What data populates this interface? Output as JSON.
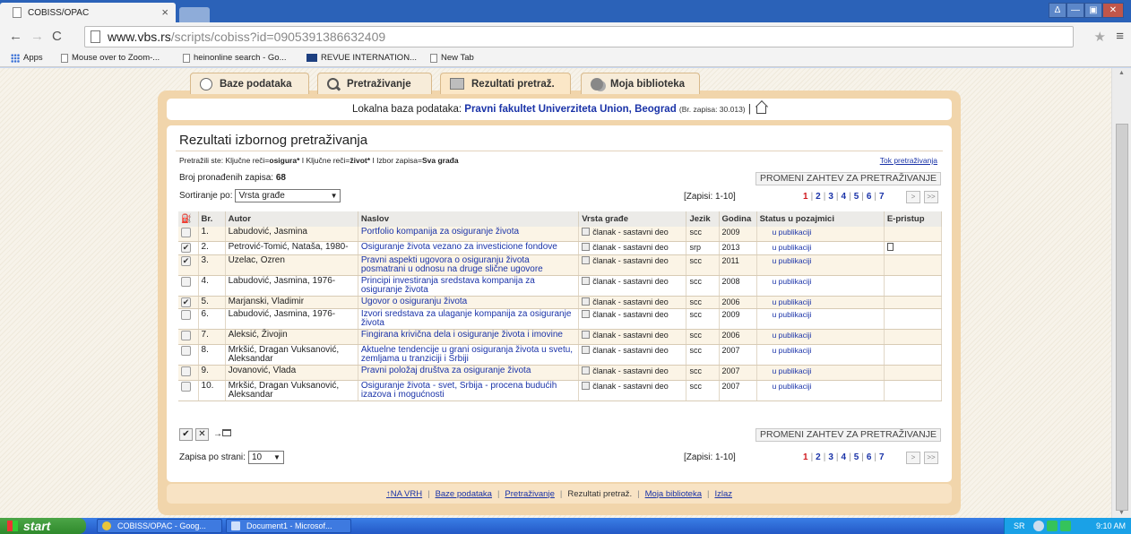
{
  "browser": {
    "tab_title": "COBISS/OPAC",
    "tab_close": "×",
    "url_domain": "www.vbs.rs",
    "url_path": "/scripts/cobiss?id=0905391386632409",
    "bookmarks": [
      "Apps",
      "Mouse over to Zoom-...",
      "heinonline search - Go...",
      "REVUE INTERNATION...",
      "New Tab"
    ],
    "window_buttons": [
      "Δ",
      "—",
      "▣",
      "✕"
    ]
  },
  "nav_tabs": [
    {
      "label": "Baze podataka"
    },
    {
      "label": "Pretraživanje"
    },
    {
      "label": "Rezultati pretraž."
    },
    {
      "label": "Moja biblioteka"
    }
  ],
  "local_db": {
    "label": "Lokalna baza podataka:",
    "institution": "Pravni fakultet Univerziteta Union, Beograd",
    "count": "(Br. zapisa: 30.013)",
    "sep": "|"
  },
  "results": {
    "title": "Rezultati izbornog pretraživanja",
    "criteria_prefix": "Pretražili ste: Ključne reči=",
    "criteria_term1": "osigura*",
    "criteria_mid": " I Ključne reči=",
    "criteria_term2": "život*",
    "criteria_mid2": " I Izbor zapisa=",
    "criteria_term3": "Sva građa",
    "flow_link": "Tok pretraživanja",
    "found_label": "Broj pronađenih zapisa:",
    "found_count": "68",
    "change_request": "PROMENI ZAHTEV ZA PRETRAŽIVANJE",
    "sort_label": "Sortiranje po:",
    "sort_value": "Vrsta građe",
    "records_range": "[Zapisi: 1-10]",
    "pages": [
      "1",
      "2",
      "3",
      "4",
      "5",
      "6",
      "7"
    ],
    "page_sep": "|",
    "next_btn": ">",
    "last_btn": ">>",
    "per_page_label": "Zapisa po strani:",
    "per_page_value": "10"
  },
  "table": {
    "headers": [
      "",
      "Br.",
      "Autor",
      "Naslov",
      "Vrsta građe",
      "Jezik",
      "Godina",
      "Status u pozajmici",
      "E-pristup"
    ],
    "rows": [
      {
        "no": "1.",
        "author": "Labudović, Jasmina",
        "title": "Portfolio kompanija za osiguranje života",
        "type": "članak - sastavni deo",
        "lang": "scc",
        "year": "2009",
        "status": "u publikaciji",
        "checked": false,
        "eaccess": false
      },
      {
        "no": "2.",
        "author": "Petrović-Tomić, Nataša, 1980-",
        "title": "Osiguranje života vezano za investicione fondove",
        "type": "članak - sastavni deo",
        "lang": "srp",
        "year": "2013",
        "status": "u publikaciji",
        "checked": true,
        "eaccess": true
      },
      {
        "no": "3.",
        "author": "Uzelac, Ozren",
        "title": "Pravni aspekti ugovora o osiguranju života posmatrani u odnosu na druge slične ugovore",
        "type": "članak - sastavni deo",
        "lang": "scc",
        "year": "2011",
        "status": "u publikaciji",
        "checked": true,
        "eaccess": false
      },
      {
        "no": "4.",
        "author": "Labudović, Jasmina, 1976-",
        "title": "Principi investiranja sredstava kompanija za osiguranje života",
        "type": "članak - sastavni deo",
        "lang": "scc",
        "year": "2008",
        "status": "u publikaciji",
        "checked": false,
        "eaccess": false
      },
      {
        "no": "5.",
        "author": "Marjanski, Vladimir",
        "title": "Ugovor o osiguranju života",
        "type": "članak - sastavni deo",
        "lang": "scc",
        "year": "2006",
        "status": "u publikaciji",
        "checked": true,
        "eaccess": false
      },
      {
        "no": "6.",
        "author": "Labudović, Jasmina, 1976-",
        "title": "Izvori sredstava za ulaganje kompanija za osiguranje života",
        "type": "članak - sastavni deo",
        "lang": "scc",
        "year": "2009",
        "status": "u publikaciji",
        "checked": false,
        "eaccess": false
      },
      {
        "no": "7.",
        "author": "Aleksić, Živojin",
        "title": "Fingirana krivična dela i osiguranje života i imovine",
        "type": "članak - sastavni deo",
        "lang": "scc",
        "year": "2006",
        "status": "u publikaciji",
        "checked": false,
        "eaccess": false
      },
      {
        "no": "8.",
        "author": "Mrkšić, Dragan Vuksanović, Aleksandar",
        "title": "Aktuelne tendencije u grani osiguranja života u svetu, zemljama u tranziciji i Srbiji",
        "type": "članak - sastavni deo",
        "lang": "scc",
        "year": "2007",
        "status": "u publikaciji",
        "checked": false,
        "eaccess": false
      },
      {
        "no": "9.",
        "author": "Jovanović, Vlada",
        "title": "Pravni položaj društva za osiguranje života",
        "type": "članak - sastavni deo",
        "lang": "scc",
        "year": "2007",
        "status": "u publikaciji",
        "checked": false,
        "eaccess": false
      },
      {
        "no": "10.",
        "author": "Mrkšić, Dragan Vuksanović, Aleksandar",
        "title": "Osiguranje života - svet, Srbija - procena budućih izazova i mogućnosti",
        "type": "članak - sastavni deo",
        "lang": "scc",
        "year": "2007",
        "status": "u publikaciji",
        "checked": false,
        "eaccess": false
      }
    ]
  },
  "footer": {
    "top_link": "NA VRH",
    "links": [
      "Baze podataka",
      "Pretraživanje",
      "Rezultati pretraž.",
      "Moja biblioteka",
      "Izlaz"
    ]
  },
  "taskbar": {
    "start": "start",
    "tasks": [
      "COBISS/OPAC - Goog...",
      "Document1 - Microsof..."
    ],
    "lang": "SR",
    "time": "9:10 AM"
  },
  "colors": {
    "link": "#1a33a8",
    "current_page": "#d0181d",
    "frame": "#f1d5ab",
    "row_alt": "#fbf4e6"
  },
  "icons": [
    "database-icon",
    "search-icon",
    "results-icon",
    "library-icon",
    "home-icon",
    "basket-icon",
    "document-icon",
    "checkbox-icon"
  ]
}
